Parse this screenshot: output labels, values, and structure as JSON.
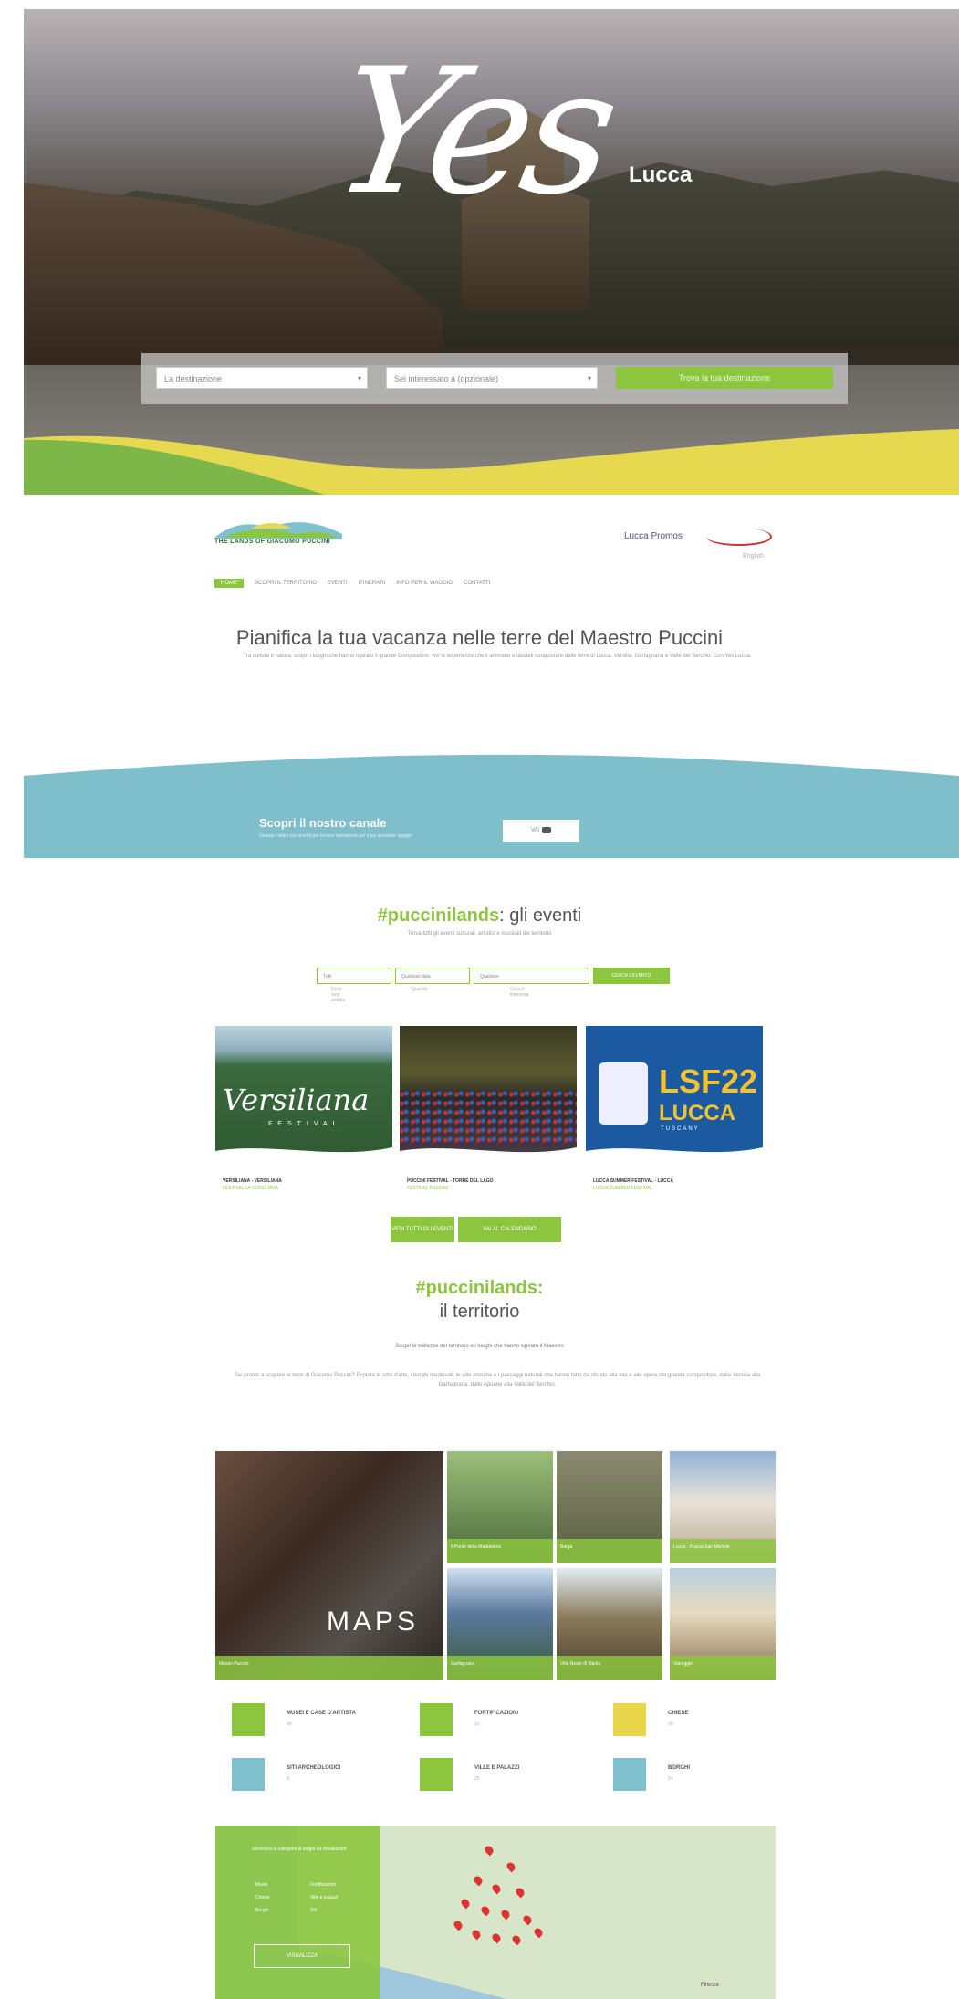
{
  "hero": {
    "logo_word": "Yes",
    "logo_place": "Lucca",
    "select_location": "La destinazione",
    "select_type": "Sei interessato a (opzionale)",
    "search_button": "Trova la tua destinazione"
  },
  "header": {
    "brand": "THE LANDS OF GIACOMO PUCCINI",
    "partner": "Lucca Promos",
    "lang": "English",
    "nav": [
      "HOME",
      "SCOPRI IL TERRITORIO",
      "EVENTI",
      "ITINERARI",
      "INFO PER IL VIAGGIO",
      "CONTATTI"
    ]
  },
  "intro": {
    "title": "Pianifica la tua vacanza nelle terre del Maestro Puccini",
    "body": "Tra cultura e natura, scopri i luoghi che hanno ispirato il grande Compositore, vivi le esperienze che li animano e lasciati conquistare dalle terre di Lucca, Versilia, Garfagnana e Valle del Serchio. Con Yes Lucca."
  },
  "channel": {
    "title": "Scopri il nostro canale",
    "subtitle": "Guarda i video più recenti per trovare ispirazione per il tuo prossimo viaggio",
    "button": "VAI"
  },
  "events": {
    "hashtag": "#puccinilands",
    "title_rest": ": gli eventi",
    "subtitle": "Trova tutti gli eventi culturali, artistici e musicali del territorio",
    "filters": [
      {
        "value": "Tutti",
        "label": "Dove vuoi andare"
      },
      {
        "value": "Qualsiasi data",
        "label": "Quando"
      },
      {
        "value": "Qualsiasi",
        "label": "Cosa ti interessa"
      }
    ],
    "filter_button": "CERCA L'EVENTO",
    "cards": [
      {
        "title": "VERSILIANA - VERSILIANA",
        "sub": "FESTIVAL LA VERSILIANA"
      },
      {
        "title": "PUCCINI FESTIVAL - TORRE DEL LAGO",
        "sub": "FESTIVAL PUCCINI"
      },
      {
        "title": "LUCCA SUMMER FESTIVAL - LUCCA",
        "sub": "LUCCA SUMMER FESTIVAL"
      }
    ],
    "card3_big": "LSF22",
    "card3_city": "LUCCA",
    "card3_region": "TUSCANY",
    "card1_logo": "Versiliana",
    "card1_tag": "FESTIVAL",
    "btn_all": "VEDI TUTTI GLI EVENTI",
    "btn_calendar": "VAI AL CALENDARIO"
  },
  "territory": {
    "hashtag": "#puccinilands:",
    "title2": "il territorio",
    "subtitle": "Scopri le bellezze del territorio e i luoghi che hanno ispirato il Maestro",
    "body": "Sei pronto a scoprire le terre di Giacomo Puccini? Esplora le città d'arte, i borghi medievali, le ville storiche e i paesaggi naturali che hanno fatto da sfondo alla vita e alle opere del grande compositore, dalla Versilia alla Garfagnana, dalle Apuane alla Valle del Serchio.",
    "maps_label": "MAPS",
    "tiles": [
      "Museo Puccini",
      "Il Ponte della Maddalena",
      "Barga",
      "Lucca - Piazza San Michele",
      "Garfagnana",
      "Villa Reale di Marlia",
      "Viareggio"
    ],
    "categories": [
      {
        "label": "MUSEI E CASE D'ARTISTA",
        "count": "18"
      },
      {
        "label": "FORTIFICAZIONI",
        "count": "12"
      },
      {
        "label": "CHIESE",
        "count": "20"
      },
      {
        "label": "SITI ARCHEOLOGICI",
        "count": "8"
      },
      {
        "label": "VILLE E PALAZZI",
        "count": "25"
      },
      {
        "label": "BORGHI",
        "count": "14"
      }
    ]
  },
  "map": {
    "panel_title": "Seleziona la categoria di luoghi da visualizzare",
    "options": [
      "Musei",
      "Fortificazioni",
      "Chiese",
      "Ville e palazzi",
      "Borghi",
      "Siti"
    ],
    "button": "VISUALIZZA",
    "city": "Firenze"
  }
}
